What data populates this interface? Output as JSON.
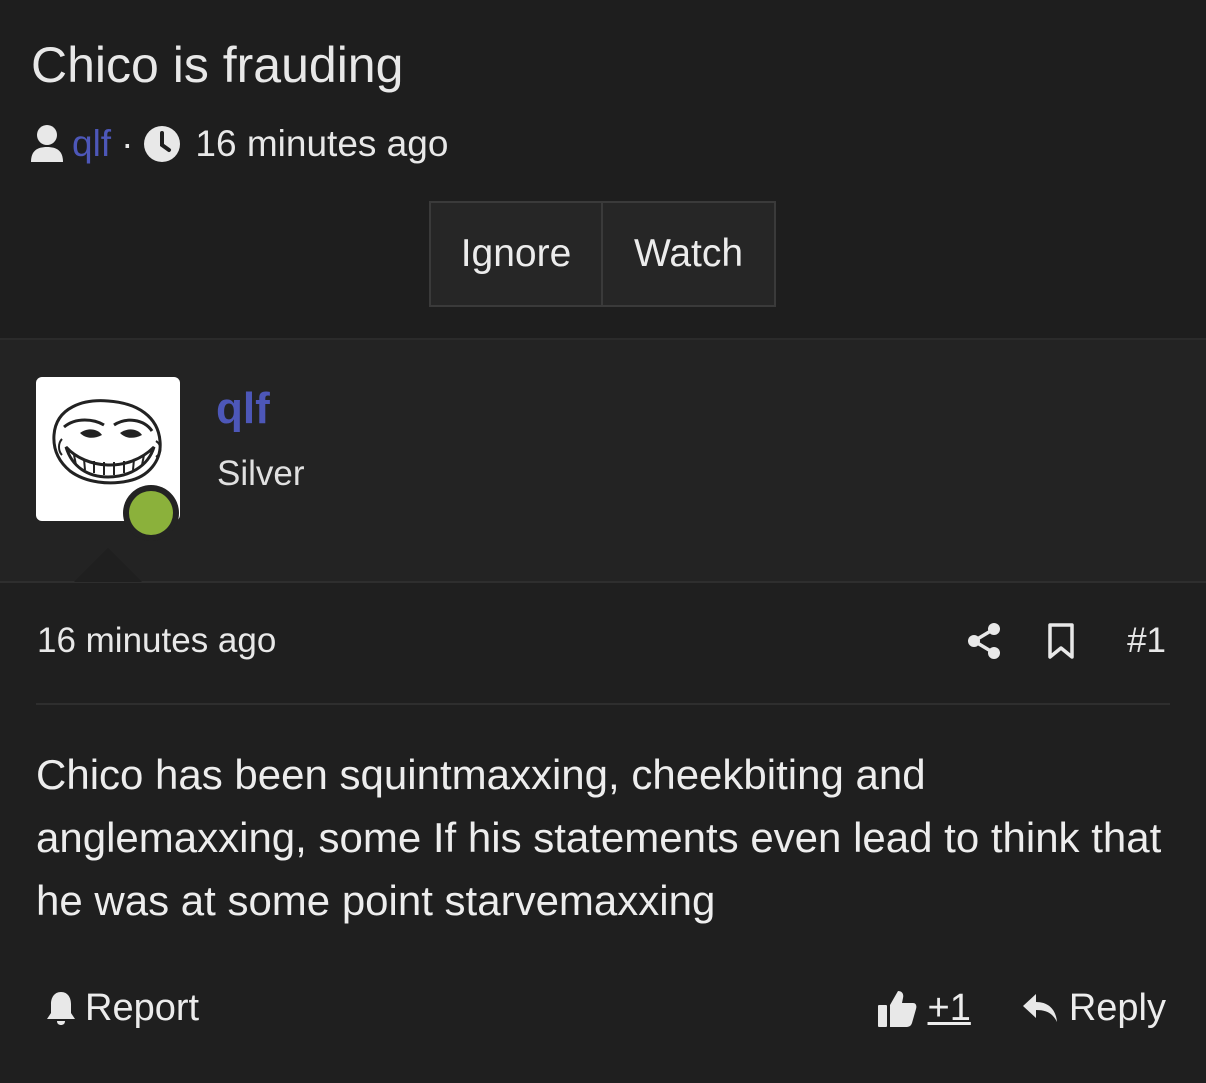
{
  "thread": {
    "title": "Chico is frauding",
    "author": "qlf",
    "separator": "·",
    "time": "16 minutes ago",
    "buttons": {
      "ignore": "Ignore",
      "watch": "Watch"
    }
  },
  "post": {
    "username": "qlf",
    "rank": "Silver",
    "online": true,
    "time": "16 minutes ago",
    "number": "#1",
    "content": "Chico has been squintmaxxing, cheekbiting and anglemaxxing, some If his statements even lead to think that he was at some point starvemaxxing",
    "report_label": "Report",
    "like_count": "+1",
    "reply_label": "Reply"
  },
  "colors": {
    "background": "#1f1f1f",
    "link": "#4d57b8",
    "online": "#8bb13b"
  },
  "icons": [
    "user-icon",
    "clock-icon",
    "share-icon",
    "bookmark-icon",
    "bell-icon",
    "thumbs-up-icon",
    "reply-icon"
  ]
}
